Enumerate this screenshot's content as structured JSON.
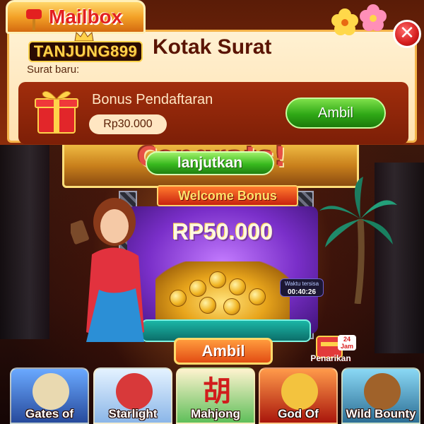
{
  "modal": {
    "tab_title": "Mailbox",
    "brand": "TANJUNG899",
    "heading": "Kotak Surat",
    "new_mail_label": "Surat baru:",
    "close_symbol": "✕",
    "mail": {
      "subject": "Bonus Pendaftaran",
      "amount": "Rp30.000",
      "claim_label": "Ambil",
      "icon": "gift-box-icon"
    }
  },
  "promo": {
    "background_title": "Congrats!",
    "continue_label": "lanjutkan",
    "banner": "Welcome Bonus",
    "prize": "RP50.000",
    "timer_label": "Waktu tersisa",
    "timer_value": "00:40:26",
    "claim_label": "Ambil",
    "withdraw_label": "Penarikan",
    "withdraw_badge": "24 Jam"
  },
  "games": [
    {
      "name": "Gates of",
      "color": "#4a7fd6"
    },
    {
      "name": "Starlight",
      "color": "#c9e3ff"
    },
    {
      "name": "Mahjong",
      "color": "#3fae47"
    },
    {
      "name": "God Of",
      "color": "#c8241a"
    },
    {
      "name": "Wild Bounty",
      "color": "#5cc0e6"
    }
  ],
  "colors": {
    "accent_green": "#2fa816",
    "accent_orange": "#e24c14",
    "title_red": "#e32020",
    "gold": "#ffd24a"
  }
}
